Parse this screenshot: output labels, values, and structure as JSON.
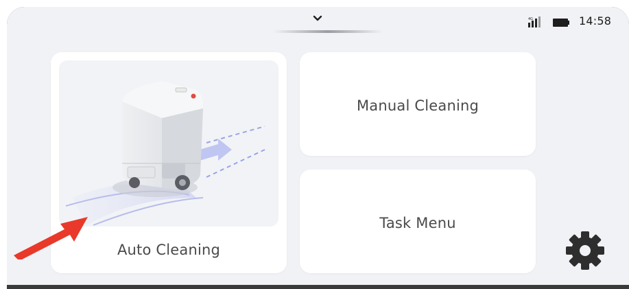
{
  "status_bar": {
    "time": "14:58",
    "icons": [
      "chevron-down-icon",
      "signal-icon",
      "battery-icon"
    ]
  },
  "cards": {
    "auto_cleaning": {
      "label": "Auto Cleaning",
      "image": "cleaning-robot-illustration"
    },
    "manual_cleaning": {
      "label": "Manual Cleaning"
    },
    "task_menu": {
      "label": "Task Menu"
    }
  },
  "settings": {
    "icon": "gear-icon"
  },
  "annotation": {
    "icon": "red-pointer-arrow"
  },
  "colors": {
    "screen_background": "#f1f2f5",
    "card_background": "#ffffff",
    "label_text": "#4a4a4a",
    "pointer_arrow": "#e8392a",
    "gear": "#2e2e2e"
  }
}
